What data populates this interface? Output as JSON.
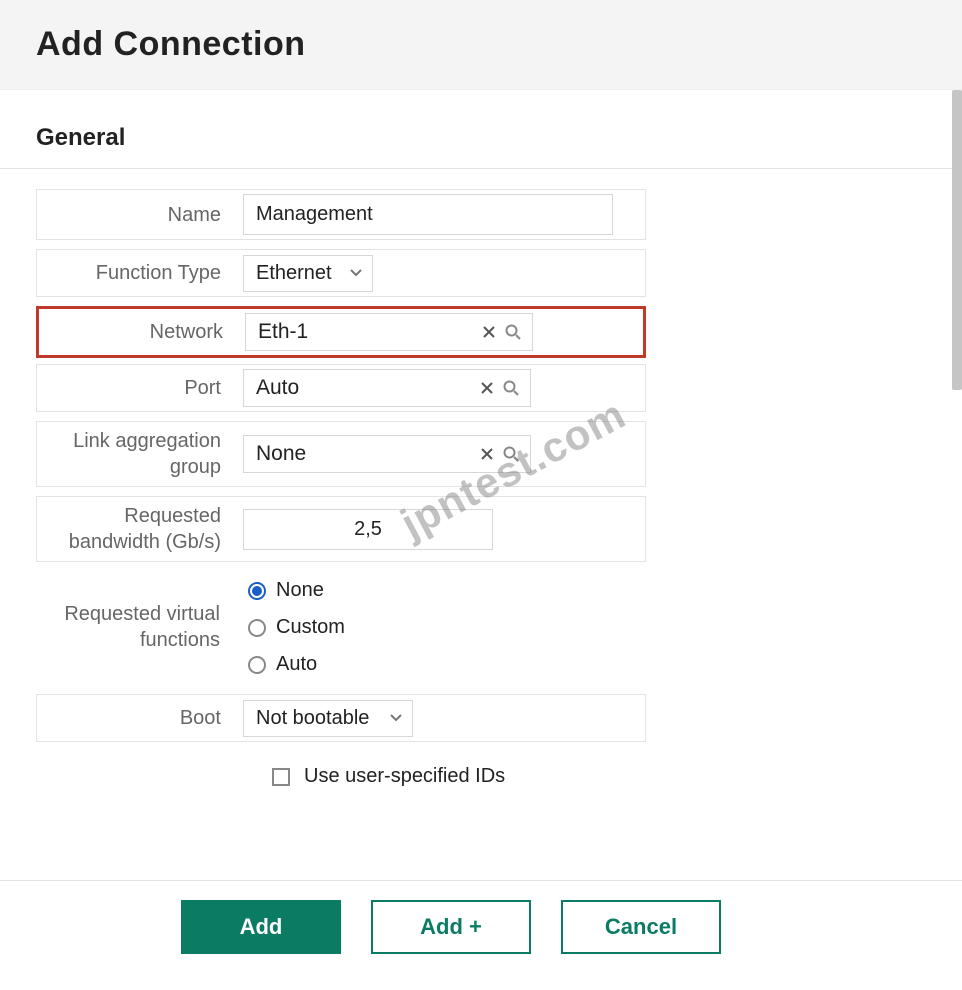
{
  "header": {
    "title": "Add Connection"
  },
  "section": {
    "title": "General"
  },
  "fields": {
    "name": {
      "label": "Name",
      "value": "Management"
    },
    "function_type": {
      "label": "Function Type",
      "value": "Ethernet"
    },
    "network": {
      "label": "Network",
      "value": "Eth-1"
    },
    "port": {
      "label": "Port",
      "value": "Auto"
    },
    "lag": {
      "label": "Link aggregation group",
      "value": "None"
    },
    "bandwidth": {
      "label": "Requested bandwidth (Gb/s)",
      "value": "2,5"
    },
    "rvf": {
      "label": "Requested virtual functions",
      "options": {
        "none": "None",
        "custom": "Custom",
        "auto": "Auto"
      },
      "selected": "none"
    },
    "boot": {
      "label": "Boot",
      "value": "Not bootable"
    },
    "use_ids": {
      "label": "Use user-specified IDs"
    }
  },
  "footer": {
    "add": "Add",
    "add_plus": "Add +",
    "cancel": "Cancel"
  },
  "watermark": "jpntest.com"
}
